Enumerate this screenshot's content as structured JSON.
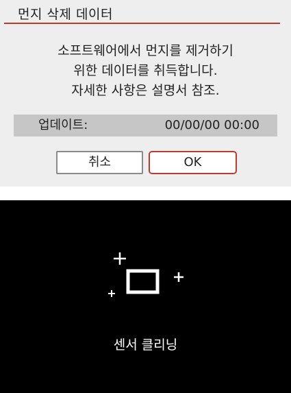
{
  "dialog": {
    "title": "먼지 삭제 데이터",
    "message_lines": [
      "소프트웨어에서 먼지를 제거하기",
      "위한 데이터를 취득합니다.",
      "자세한 사항은 설명서 참조."
    ],
    "update": {
      "label": "업데이트:",
      "value": "00/00/00  00:00"
    },
    "buttons": {
      "cancel_label": "취소",
      "ok_label": "OK"
    },
    "colors": {
      "accent": "#c0392b",
      "background": "#eeeeee",
      "bar": "#c6c6c6"
    }
  },
  "cleaning": {
    "label": "센서 클리닝",
    "icon": "sensor-cleaning-icon",
    "colors": {
      "background": "#000000",
      "foreground": "#ffffff"
    }
  }
}
